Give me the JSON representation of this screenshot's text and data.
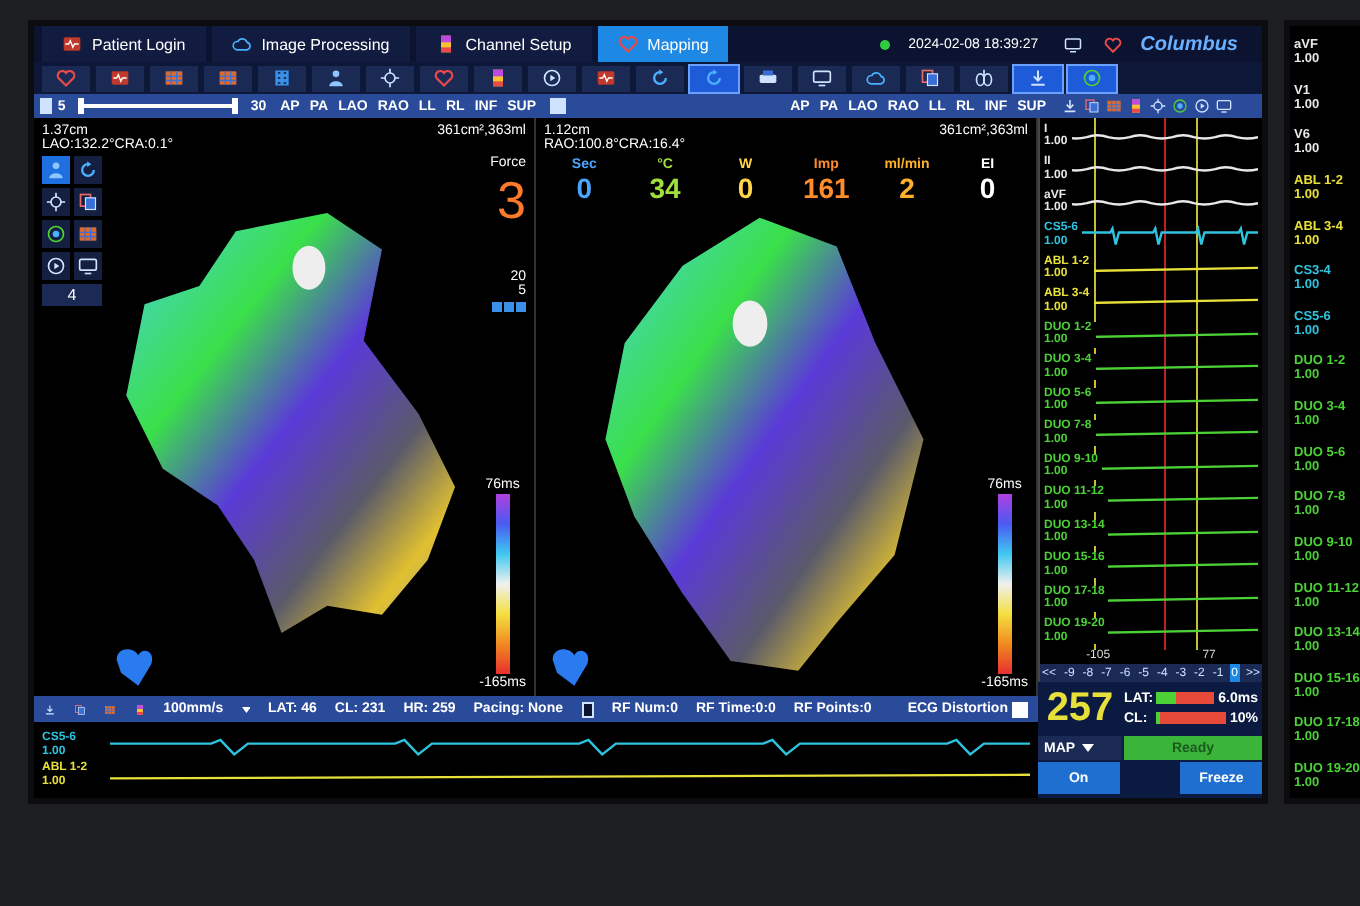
{
  "tabs": [
    {
      "label": "Patient Login",
      "selected": false
    },
    {
      "label": "Image Processing",
      "selected": false
    },
    {
      "label": "Channel Setup",
      "selected": false
    },
    {
      "label": "Mapping",
      "selected": true
    }
  ],
  "header": {
    "datetime": "2024-02-08 18:39:27",
    "logo": "Columbus"
  },
  "toolbar": [
    {
      "kind": "heart",
      "selected": false
    },
    {
      "kind": "ecg",
      "selected": false
    },
    {
      "kind": "grid",
      "selected": false
    },
    {
      "kind": "grid",
      "selected": false
    },
    {
      "kind": "film",
      "selected": false
    },
    {
      "kind": "person",
      "selected": false
    },
    {
      "kind": "crosshair",
      "selected": false
    },
    {
      "kind": "heart",
      "selected": false
    },
    {
      "kind": "bars",
      "selected": false
    },
    {
      "kind": "play",
      "selected": false
    },
    {
      "kind": "ecg",
      "selected": false
    },
    {
      "kind": "refresh",
      "selected": false
    },
    {
      "kind": "refresh",
      "selected": true
    },
    {
      "kind": "printer",
      "selected": false
    },
    {
      "kind": "monitor",
      "selected": false
    },
    {
      "kind": "cloud",
      "selected": false
    },
    {
      "kind": "copy",
      "selected": false
    },
    {
      "kind": "lungs",
      "selected": false
    },
    {
      "kind": "download",
      "selected": true
    },
    {
      "kind": "target",
      "selected": true
    }
  ],
  "view_bar": {
    "range_slider": {
      "low_label": "5",
      "high_label": "30",
      "level": 1
    },
    "left_views": [
      "AP",
      "PA",
      "LAO",
      "RAO",
      "LL",
      "RL",
      "INF",
      "SUP"
    ],
    "right_views": [
      "AP",
      "PA",
      "LAO",
      "RAO",
      "LL",
      "RL",
      "INF",
      "SUP"
    ]
  },
  "panes": [
    {
      "size": "1.37cm",
      "angle": "LAO:132.2°CRA:0.1°",
      "volume": "361cm²,363ml",
      "tools": [
        {
          "kind": "person",
          "selected": true
        },
        {
          "kind": "refresh",
          "selected": false
        },
        {
          "kind": "crosshair",
          "selected": false
        },
        {
          "kind": "copy",
          "selected": false
        },
        {
          "kind": "target",
          "selected": false
        },
        {
          "kind": "grid",
          "selected": false
        },
        {
          "kind": "play",
          "selected": false
        },
        {
          "kind": "monitor",
          "selected": false
        }
      ],
      "tool_value": "4",
      "force": {
        "label": "Force",
        "value": "3"
      },
      "ticks": [
        "20",
        "5"
      ],
      "scale_max": "76ms",
      "scale_min": "-165ms"
    },
    {
      "size": "1.12cm",
      "angle": "RAO:100.8°CRA:16.4°",
      "volume": "361cm²,363ml",
      "stats": [
        {
          "label": "Sec",
          "value": "0",
          "color": "#4aa3ff"
        },
        {
          "label": "°C",
          "value": "34",
          "color": "#9fe03a"
        },
        {
          "label": "W",
          "value": "0",
          "color": "#ffd54a"
        },
        {
          "label": "Imp",
          "value": "161",
          "color": "#ff8c2a"
        },
        {
          "label": "ml/min",
          "value": "2",
          "color": "#ffb02a"
        },
        {
          "label": "EI",
          "value": "0",
          "color": "#ffffff"
        }
      ],
      "scale_max": "76ms",
      "scale_min": "-165ms"
    }
  ],
  "ecg": {
    "channels": [
      {
        "label": "I",
        "scale": "1.00",
        "color": "#e8e8e8",
        "kind": "wavy"
      },
      {
        "label": "II",
        "scale": "1.00",
        "color": "#e8e8e8",
        "kind": "wavy"
      },
      {
        "label": "aVF",
        "scale": "1.00",
        "color": "#e8e8e8",
        "kind": "wavy"
      },
      {
        "label": "CS5-6",
        "scale": "1.00",
        "color": "#2ec4e0",
        "kind": "beats"
      },
      {
        "label": "ABL 1-2",
        "scale": "1.00",
        "color": "#e8e03a",
        "kind": "flat"
      },
      {
        "label": "ABL 3-4",
        "scale": "1.00",
        "color": "#e8e03a",
        "kind": "flat"
      },
      {
        "label": "DUO 1-2",
        "scale": "1.00",
        "color": "#4cd137",
        "kind": "flat"
      },
      {
        "label": "DUO 3-4",
        "scale": "1.00",
        "color": "#4cd137",
        "kind": "flat"
      },
      {
        "label": "DUO 5-6",
        "scale": "1.00",
        "color": "#4cd137",
        "kind": "flat"
      },
      {
        "label": "DUO 7-8",
        "scale": "1.00",
        "color": "#4cd137",
        "kind": "flat"
      },
      {
        "label": "DUO 9-10",
        "scale": "1.00",
        "color": "#4cd137",
        "kind": "flat"
      },
      {
        "label": "DUO 11-12",
        "scale": "1.00",
        "color": "#4cd137",
        "kind": "flat"
      },
      {
        "label": "DUO 13-14",
        "scale": "1.00",
        "color": "#4cd137",
        "kind": "flat"
      },
      {
        "label": "DUO 15-16",
        "scale": "1.00",
        "color": "#4cd137",
        "kind": "flat"
      },
      {
        "label": "DUO 17-18",
        "scale": "1.00",
        "color": "#4cd137",
        "kind": "flat"
      },
      {
        "label": "DUO 19-20",
        "scale": "1.00",
        "color": "#4cd137",
        "kind": "flat"
      }
    ],
    "time_marks": [
      "-105",
      "77"
    ],
    "offsets": [
      {
        "label": "<<",
        "selected": false
      },
      {
        "label": "-9",
        "selected": false
      },
      {
        "label": "-8",
        "selected": false
      },
      {
        "label": "-7",
        "selected": false
      },
      {
        "label": "-6",
        "selected": false
      },
      {
        "label": "-5",
        "selected": false
      },
      {
        "label": "-4",
        "selected": false
      },
      {
        "label": "-3",
        "selected": false
      },
      {
        "label": "-2",
        "selected": false
      },
      {
        "label": "-1",
        "selected": false
      },
      {
        "label": "0",
        "selected": true
      },
      {
        "label": ">>",
        "selected": false
      }
    ]
  },
  "status": {
    "speed": "100mm/s",
    "items": [
      "LAT: 46",
      "CL: 231",
      "HR: 259",
      "Pacing: None"
    ],
    "rf": [
      "RF Num:0",
      "RF Time:0:0",
      "RF Points:0"
    ],
    "ecg_distortion": {
      "label": "ECG Distortion",
      "checked": false
    }
  },
  "strip": [
    {
      "label": "CS5-6",
      "scale": "1.00",
      "color": "#2ec4e0",
      "kind": "beats"
    },
    {
      "label": "ABL 1-2",
      "scale": "1.00",
      "color": "#e8e03a",
      "kind": "flat"
    }
  ],
  "info": {
    "value": "257",
    "bars": [
      {
        "label": "LAT:",
        "level": 0.35,
        "reading": "6.0ms"
      },
      {
        "label": "CL:",
        "level": 0.05,
        "reading": "10%"
      }
    ],
    "mode": "MAP",
    "status": "Ready",
    "buttons": [
      "On",
      "Freeze"
    ]
  },
  "side_monitor": [
    {
      "label": "aVF",
      "scale": "1.00",
      "color": "#e8e8e8"
    },
    {
      "label": "V1",
      "scale": "1.00",
      "color": "#e8e8e8"
    },
    {
      "label": "V6",
      "scale": "1.00",
      "color": "#e8e8e8"
    },
    {
      "label": "ABL 1-2",
      "scale": "1.00",
      "color": "#e8e03a"
    },
    {
      "label": "ABL 3-4",
      "scale": "1.00",
      "color": "#e8e03a"
    },
    {
      "label": "CS3-4",
      "scale": "1.00",
      "color": "#2ec4e0"
    },
    {
      "label": "CS5-6",
      "scale": "1.00",
      "color": "#2ec4e0"
    },
    {
      "label": "DUO 1-2",
      "scale": "1.00",
      "color": "#4cd137"
    },
    {
      "label": "DUO 3-4",
      "scale": "1.00",
      "color": "#4cd137"
    },
    {
      "label": "DUO 5-6",
      "scale": "1.00",
      "color": "#4cd137"
    },
    {
      "label": "DUO 7-8",
      "scale": "1.00",
      "color": "#4cd137"
    },
    {
      "label": "DUO 9-10",
      "scale": "1.00",
      "color": "#4cd137"
    },
    {
      "label": "DUO 11-12",
      "scale": "1.00",
      "color": "#4cd137"
    },
    {
      "label": "DUO 13-14",
      "scale": "1.00",
      "color": "#4cd137"
    },
    {
      "label": "DUO 15-16",
      "scale": "1.00",
      "color": "#4cd137"
    },
    {
      "label": "DUO 17-18",
      "scale": "1.00",
      "color": "#4cd137"
    },
    {
      "label": "DUO 19-20",
      "scale": "1.00",
      "color": "#4cd137"
    }
  ]
}
